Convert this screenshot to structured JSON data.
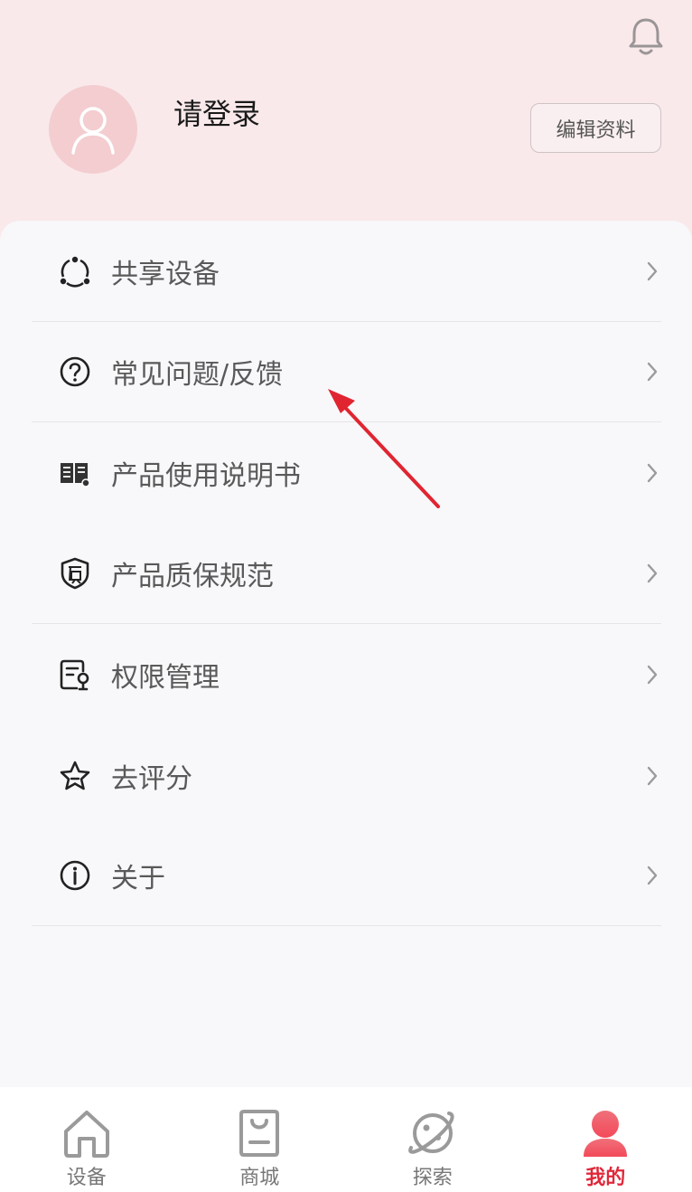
{
  "header": {
    "login_prompt": "请登录",
    "edit_profile_label": "编辑资料"
  },
  "menu": {
    "items": [
      {
        "label": "共享设备",
        "icon": "share-devices-icon"
      },
      {
        "label": "常见问题/反馈",
        "icon": "question-circle-icon"
      },
      {
        "label": "产品使用说明书",
        "icon": "manual-book-icon"
      },
      {
        "label": "产品质保规范",
        "icon": "warranty-shield-icon"
      },
      {
        "label": "权限管理",
        "icon": "permission-icon"
      },
      {
        "label": "去评分",
        "icon": "star-icon"
      },
      {
        "label": "关于",
        "icon": "info-icon"
      }
    ]
  },
  "tabbar": {
    "tabs": [
      {
        "label": "设备",
        "icon": "home-icon",
        "active": false
      },
      {
        "label": "商城",
        "icon": "shopping-bag-icon",
        "active": false
      },
      {
        "label": "探索",
        "icon": "planet-icon",
        "active": false
      },
      {
        "label": "我的",
        "icon": "user-icon",
        "active": true
      }
    ]
  },
  "colors": {
    "header_bg": "#f9e9ea",
    "active_tab": "#e0283a",
    "annotation_arrow": "#e02531"
  }
}
